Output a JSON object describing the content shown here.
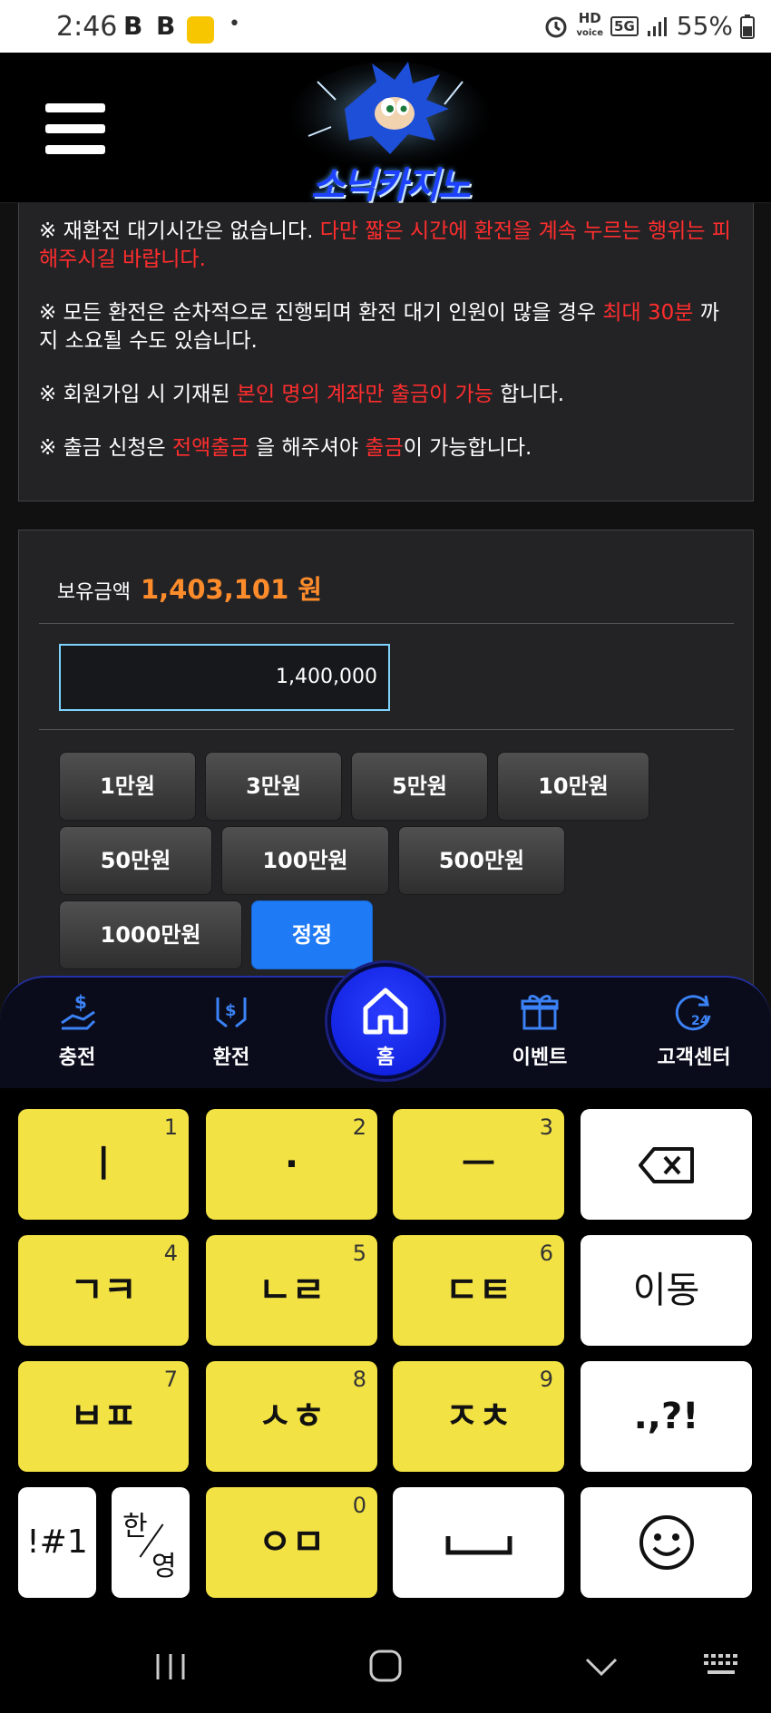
{
  "status_bar": {
    "time": "2:46",
    "icons_left": [
      "b-app-icon",
      "b-app-icon",
      "kakao-icon",
      "dot-icon"
    ],
    "left_glyphs": [
      "B",
      "B",
      "•"
    ],
    "hd": "HD",
    "hd_sub": "voice",
    "net": "5G",
    "battery": "55%"
  },
  "header": {
    "logo_text": "소닉카지노"
  },
  "notice": {
    "n1_a": "※ 재환전 대기시간은 없습니다. ",
    "n1_b": "다만 짧은 시간에 환전을 계속 누르는 행위는 피해주시길 바랍니다.",
    "n2_a": "※ 모든 환전은 순차적으로 진행되며 환전 대기 인원이 많을 경우 ",
    "n2_b": "최대 30분",
    "n2_c": " 까지 소요될 수도 있습니다.",
    "n3_a": "※ 회원가입 시 기재된 ",
    "n3_b": "본인 명의 계좌만 출금이 가능",
    "n3_c": " 합니다.",
    "n4_a": "※ 출금 신청은 ",
    "n4_b": "전액출금",
    "n4_c": " 을 해주셔야 ",
    "n4_d": "출금",
    "n4_e": "이 가능합니다."
  },
  "withdraw": {
    "balance_label": "보유금액",
    "balance_value": "1,403,101 원",
    "amount_value": "1,400,000",
    "buttons": [
      "1만원",
      "3만원",
      "5만원",
      "10만원",
      "50만원",
      "100만원",
      "500만원",
      "1000만원",
      "정정"
    ]
  },
  "bottom_nav": {
    "items": [
      "충전",
      "환전",
      "홈",
      "이벤트",
      "고객센터"
    ]
  },
  "keyboard": {
    "keys": [
      {
        "main": "ㅣ",
        "num": "1"
      },
      {
        "main": "·",
        "num": "2"
      },
      {
        "main": "ㅡ",
        "num": "3"
      },
      {
        "main": "ㄱㅋ",
        "num": "4"
      },
      {
        "main": "ㄴㄹ",
        "num": "5"
      },
      {
        "main": "ㄷㅌ",
        "num": "6"
      },
      {
        "main": "ㅂㅍ",
        "num": "7"
      },
      {
        "main": "ㅅㅎ",
        "num": "8"
      },
      {
        "main": "ㅈㅊ",
        "num": "9"
      },
      {
        "main": "ㅇㅁ",
        "num": "0"
      }
    ],
    "move": "이동",
    "punct": ".,?!",
    "symbols": "!#1",
    "lang_top": "한",
    "lang_bottom": "영"
  },
  "colors": {
    "accent_red": "#ff2d2d",
    "balance_orange": "#ff8c2b",
    "nav_blue": "#2a3dff",
    "key_yellow": "#f3e244"
  }
}
